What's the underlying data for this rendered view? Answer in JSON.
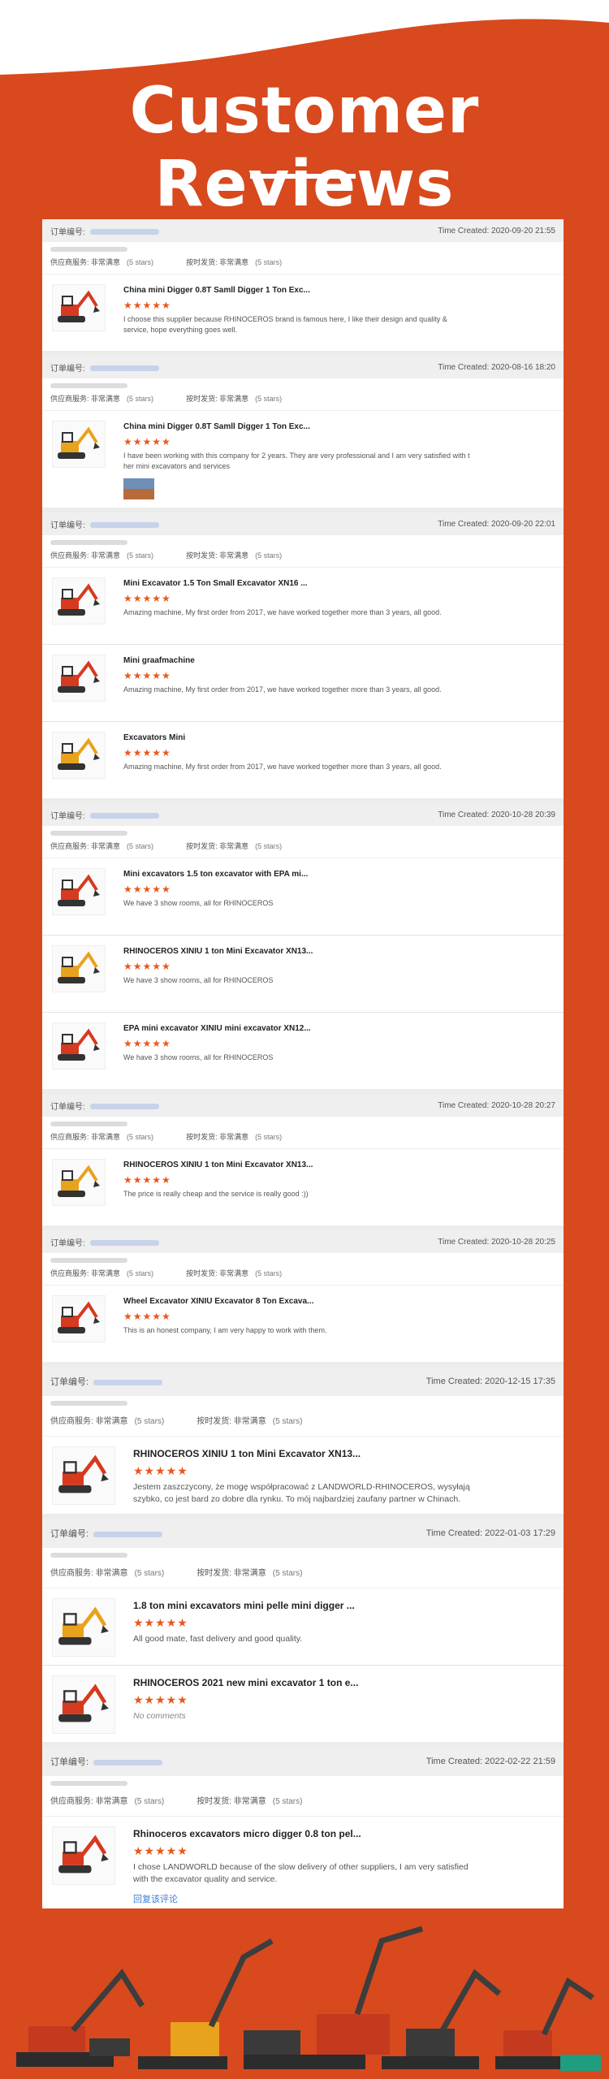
{
  "header": {
    "title": "Customer Reviews"
  },
  "labels": {
    "order_no": "订单编号:",
    "time_created": "Time Created:"
  },
  "service": {
    "supplier_label": "供应商服务:",
    "delivery_label": "按时发货:",
    "value": "非常满意",
    "stars_text": "(5 stars)"
  },
  "rating_stars": "★★★★★",
  "orders": [
    {
      "time": "2020-09-20 21:55",
      "items": [
        {
          "title": "China mini Digger 0.8T Samll Digger 1 Ton Exc...",
          "comment": "I choose this supplier because RHINOCEROS brand is famous here, I like their design and quality & service, hope everything goes well."
        }
      ]
    },
    {
      "time": "2020-08-16 18:20",
      "items": [
        {
          "title": "China mini Digger 0.8T Samll Digger 1 Ton Exc...",
          "comment": "I have been working with this company for 2 years. They are very professional and I am very satisfied with t her mini excavators and services"
        }
      ]
    },
    {
      "time": "2020-09-20 22:01",
      "items": [
        {
          "title": "Mini Excavator 1.5 Ton Small Excavator XN16 ...",
          "comment": "Amazing machine, My first order from 2017, we have worked together more than 3 years, all good."
        },
        {
          "title": "Mini graafmachine",
          "comment": "Amazing machine, My first order from 2017, we have worked together more than 3 years, all good."
        },
        {
          "title": "Excavators Mini",
          "comment": "Amazing machine, My first order from 2017, we have worked together more than 3 years, all good."
        }
      ]
    },
    {
      "time": "2020-10-28 20:39",
      "items": [
        {
          "title": "Mini excavators 1.5 ton excavator with EPA mi...",
          "comment": "We have 3 show rooms, all for RHINOCEROS"
        },
        {
          "title": "RHINOCEROS XINIU 1 ton Mini Excavator XN13...",
          "comment": "We have 3 show rooms, all for RHINOCEROS"
        },
        {
          "title": "EPA mini excavator XINIU mini excavator XN12...",
          "comment": "We have 3 show rooms, all for RHINOCEROS"
        }
      ]
    },
    {
      "time": "2020-10-28 20:27",
      "items": [
        {
          "title": "RHINOCEROS XINIU 1 ton Mini Excavator XN13...",
          "comment": "The price is really cheap and the service is really good :))"
        }
      ]
    },
    {
      "time": "2020-10-28 20:25",
      "items": [
        {
          "title": "Wheel Excavator XINIU Excavator 8 Ton Excava...",
          "comment": "This is an honest company, I am very happy to work with them."
        }
      ]
    },
    {
      "time": "2020-12-15 17:35",
      "items": [
        {
          "title": "RHINOCEROS XINIU 1 ton Mini Excavator XN13...",
          "comment": "Jestem zaszczycony, że mogę współpracować z LANDWORLD-RHINOCEROS, wysyłają szybko, co jest bard zo dobre dla rynku. To mój najbardziej zaufany partner w Chinach."
        }
      ]
    },
    {
      "time": "2022-01-03 17:29",
      "items": [
        {
          "title": "1.8 ton mini excavators mini pelle mini digger ...",
          "comment": "All good mate, fast delivery and good quality."
        },
        {
          "title": "RHINOCEROS 2021 new mini excavator 1 ton e...",
          "comment": "No comments"
        }
      ]
    },
    {
      "time": "2022-02-22 21:59",
      "items": [
        {
          "title": "Rhinoceros excavators micro digger 0.8 ton pel...",
          "comment": "I chose LANDWORLD because of the slow delivery of other suppliers, I am very satisfied with the excavator quality and service."
        }
      ],
      "reply": "回复该评论"
    }
  ]
}
